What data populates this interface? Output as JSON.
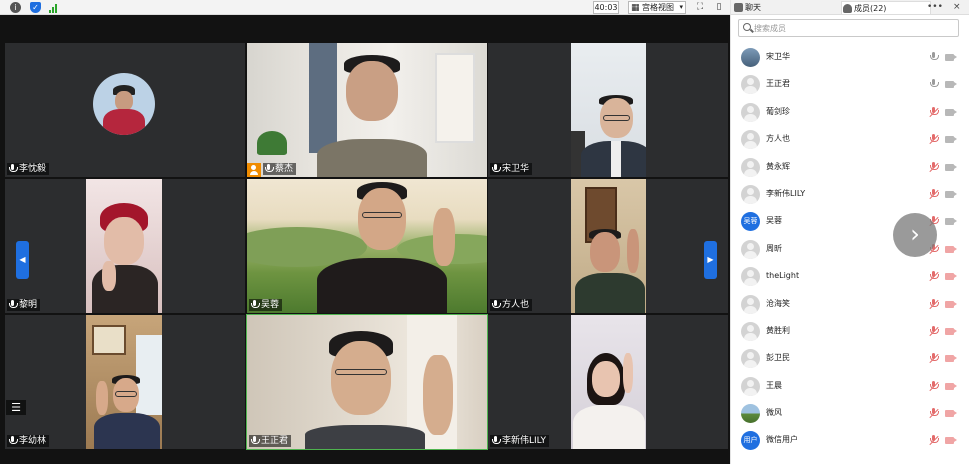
{
  "toolbar": {
    "timer": "40:03",
    "view_mode": "宫格视图",
    "icons": [
      "info-icon",
      "shield-icon",
      "signal-icon",
      "fullscreen-icon",
      "window-icon",
      "minimize-icon"
    ]
  },
  "grid": {
    "tiles": [
      {
        "name": "李忱毅",
        "video": false
      },
      {
        "name": "蔡杰",
        "video": true,
        "host": true
      },
      {
        "name": "宋卫华",
        "video": true
      },
      {
        "name": "黎明",
        "video": true
      },
      {
        "name": "吴蓉",
        "video": true
      },
      {
        "name": "方人也",
        "video": true
      },
      {
        "name": "李幼林",
        "video": true
      },
      {
        "name": "王正君",
        "video": true,
        "active_speaker": true
      },
      {
        "name": "李新伟LILY",
        "video": true
      }
    ]
  },
  "panel": {
    "tab_chat": "聊天",
    "tab_members": "成员(22)",
    "search_placeholder": "搜索成员",
    "members": [
      {
        "name": "宋卫华",
        "avatar": "photo",
        "muted": false,
        "camera": true
      },
      {
        "name": "王正君",
        "avatar": "default",
        "muted": false,
        "camera": true
      },
      {
        "name": "葡剑珍",
        "avatar": "default",
        "muted": true,
        "camera": true
      },
      {
        "name": "方人也",
        "avatar": "default",
        "muted": true,
        "camera": true
      },
      {
        "name": "黄永辉",
        "avatar": "default",
        "muted": true,
        "camera": true
      },
      {
        "name": "李新伟LILY",
        "avatar": "default",
        "muted": true,
        "camera": true
      },
      {
        "name": "吴蓉",
        "avatar": "text",
        "avatar_text": "吴蓉",
        "muted": true,
        "camera": true
      },
      {
        "name": "周昕",
        "avatar": "default",
        "muted": true,
        "camera": false
      },
      {
        "name": "theLight",
        "avatar": "default",
        "muted": true,
        "camera": false
      },
      {
        "name": "沧海笑",
        "avatar": "default",
        "muted": true,
        "camera": false
      },
      {
        "name": "黄胜利",
        "avatar": "default",
        "muted": true,
        "camera": false
      },
      {
        "name": "彭卫民",
        "avatar": "default",
        "muted": true,
        "camera": false
      },
      {
        "name": "王晨",
        "avatar": "default",
        "muted": true,
        "camera": false
      },
      {
        "name": "微风",
        "avatar": "landscape",
        "muted": true,
        "camera": false
      },
      {
        "name": "微信用户",
        "avatar": "text",
        "avatar_text": "用户",
        "muted": true,
        "camera": false
      }
    ]
  },
  "colors": {
    "accent": "#1f6fe0",
    "host_badge": "#f08c00",
    "active_border": "#4fb34f",
    "muted": "#e36b6b"
  }
}
